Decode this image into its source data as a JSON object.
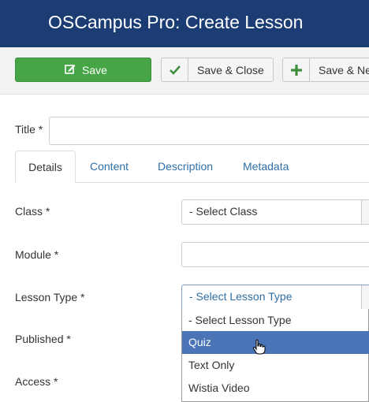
{
  "header": {
    "title": "OSCampus Pro: Create Lesson"
  },
  "toolbar": {
    "save_label": "Save",
    "save_close_label": "Save & Close",
    "save_new_label": "Save & New"
  },
  "form": {
    "title_label": "Title *",
    "title_value": "",
    "class_label": "Class *",
    "class_value": "- Select Class",
    "module_label": "Module *",
    "module_value": "",
    "lesson_type_label": "Lesson Type *",
    "lesson_type_value": "- Select Lesson Type",
    "published_label": "Published *",
    "access_label": "Access *"
  },
  "tabs": [
    {
      "label": "Details",
      "active": true
    },
    {
      "label": "Content"
    },
    {
      "label": "Description"
    },
    {
      "label": "Metadata"
    }
  ],
  "lesson_type_options": [
    {
      "label": "- Select Lesson Type"
    },
    {
      "label": "Quiz",
      "highlighted": true
    },
    {
      "label": "Text Only"
    },
    {
      "label": "Wistia Video"
    }
  ],
  "colors": {
    "header_bg": "#1c3d74",
    "save_green": "#46a546",
    "link_blue": "#2f6fa7",
    "highlight": "#4a74b5"
  }
}
